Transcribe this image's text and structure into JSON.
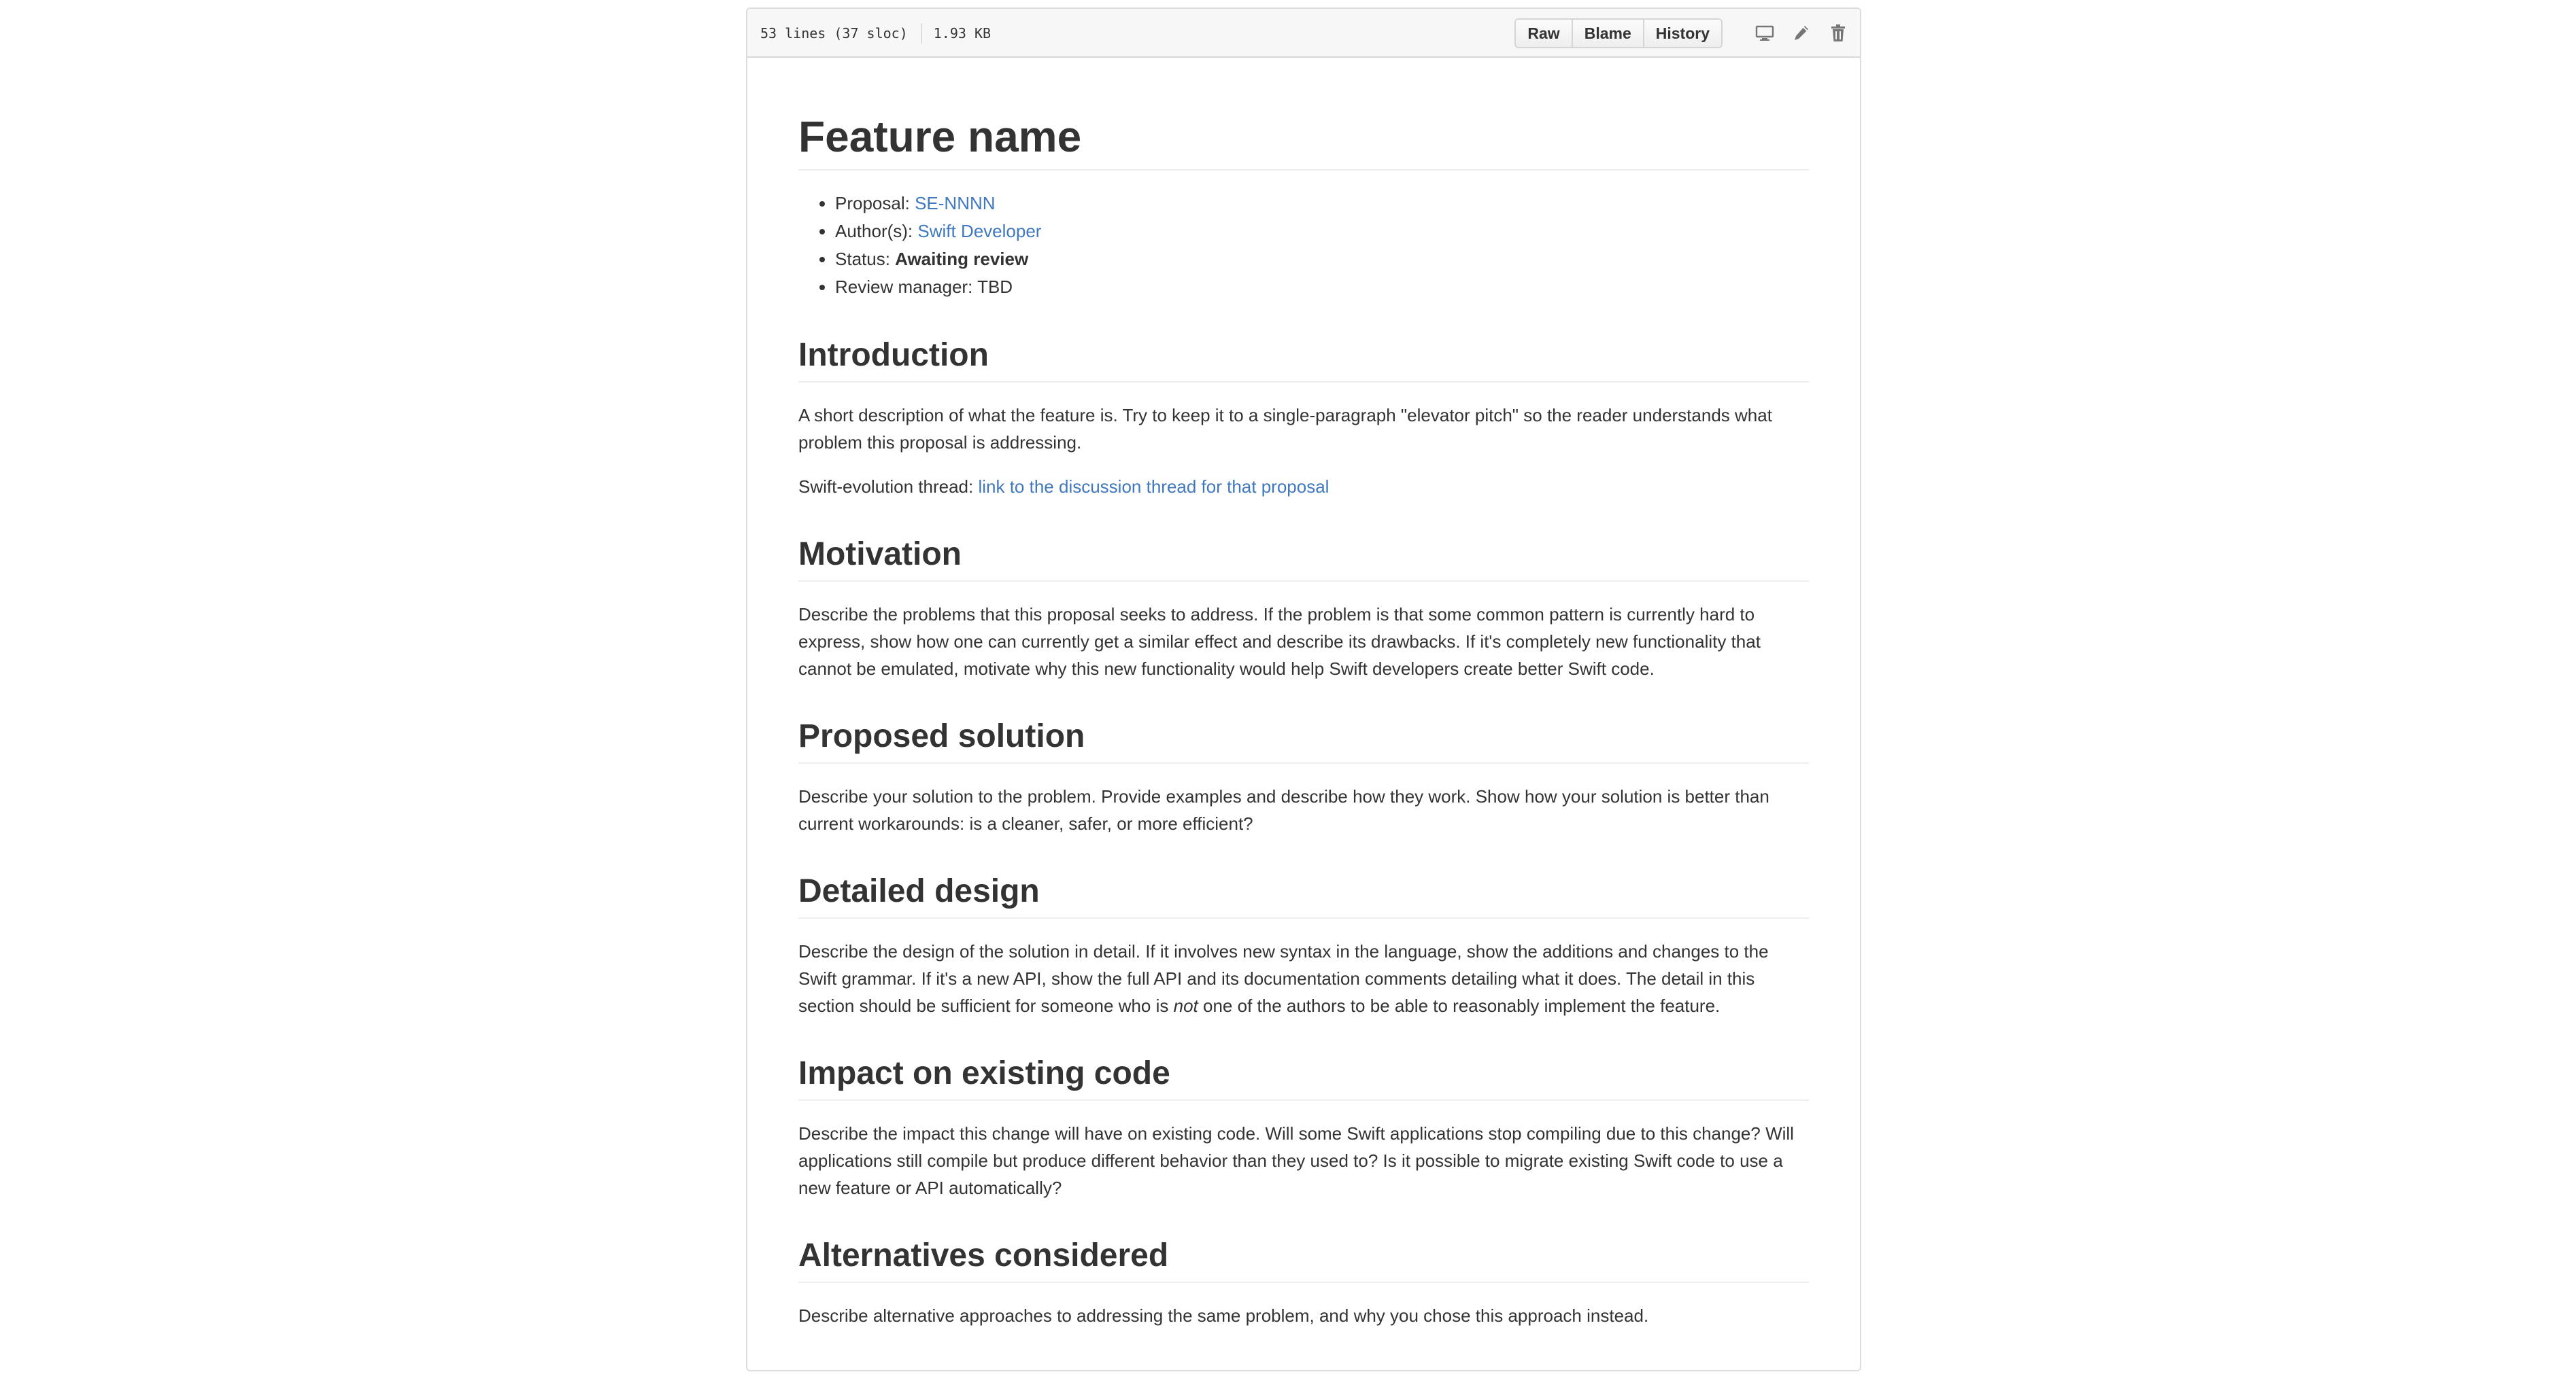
{
  "file_header": {
    "lines_info": "53 lines (37 sloc)",
    "file_size": "1.93 KB",
    "buttons": {
      "raw": "Raw",
      "blame": "Blame",
      "history": "History"
    },
    "icons": [
      "desktop-icon",
      "pencil-icon",
      "trash-icon"
    ]
  },
  "document": {
    "title": "Feature name",
    "meta": {
      "proposal_label": "Proposal: ",
      "proposal_link": "SE-NNNN",
      "authors_label": "Author(s): ",
      "authors_link": "Swift Developer",
      "status_label": "Status: ",
      "status_value": "Awaiting review",
      "review_manager": "Review manager: TBD"
    },
    "introduction": {
      "heading": "Introduction",
      "paragraph": "A short description of what the feature is. Try to keep it to a single-paragraph \"elevator pitch\" so the reader understands what problem this proposal is addressing.",
      "thread_label": "Swift-evolution thread: ",
      "thread_link": "link to the discussion thread for that proposal"
    },
    "motivation": {
      "heading": "Motivation",
      "paragraph": "Describe the problems that this proposal seeks to address. If the problem is that some common pattern is currently hard to express, show how one can currently get a similar effect and describe its drawbacks. If it's completely new functionality that cannot be emulated, motivate why this new functionality would help Swift developers create better Swift code."
    },
    "proposed_solution": {
      "heading": "Proposed solution",
      "paragraph": "Describe your solution to the problem. Provide examples and describe how they work. Show how your solution is better than current workarounds: is a cleaner, safer, or more efficient?"
    },
    "detailed_design": {
      "heading": "Detailed design",
      "paragraph_before": "Describe the design of the solution in detail. If it involves new syntax in the language, show the additions and changes to the Swift grammar. If it's a new API, show the full API and its documentation comments detailing what it does. The detail in this section should be sufficient for someone who is ",
      "emphasis": "not",
      "paragraph_after": " one of the authors to be able to reasonably implement the feature."
    },
    "impact": {
      "heading": "Impact on existing code",
      "paragraph": "Describe the impact this change will have on existing code. Will some Swift applications stop compiling due to this change? Will applications still compile but produce different behavior than they used to? Is it possible to migrate existing Swift code to use a new feature or API automatically?"
    },
    "alternatives": {
      "heading": "Alternatives considered",
      "paragraph": "Describe alternative approaches to addressing the same problem, and why you chose this approach instead."
    }
  },
  "colors": {
    "link": "#4078c0",
    "text": "#333333",
    "border": "#dddddd",
    "header_bg": "#f7f7f7",
    "icon": "#767676"
  }
}
